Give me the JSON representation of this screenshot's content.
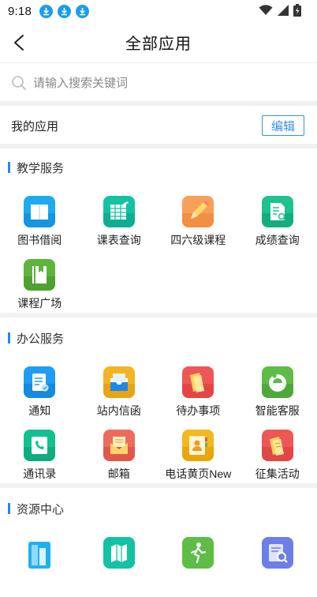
{
  "status": {
    "time": "9:18"
  },
  "header": {
    "title": "全部应用"
  },
  "search": {
    "placeholder": "请输入搜索关键词"
  },
  "my_apps": {
    "label": "我的应用",
    "edit_label": "编辑"
  },
  "sections": [
    {
      "title": "教学服务",
      "apps": [
        {
          "name": "图书借阅",
          "icon": "book-icon"
        },
        {
          "name": "课表查询",
          "icon": "timetable-icon"
        },
        {
          "name": "四六级课程",
          "icon": "pencil-icon"
        },
        {
          "name": "成绩查询",
          "icon": "score-search-icon"
        },
        {
          "name": "课程广场",
          "icon": "course-book-icon"
        }
      ]
    },
    {
      "title": "办公服务",
      "apps": [
        {
          "name": "通知",
          "icon": "notice-icon"
        },
        {
          "name": "站内信函",
          "icon": "inbox-icon"
        },
        {
          "name": "待办事项",
          "icon": "todo-icon"
        },
        {
          "name": "智能客服",
          "icon": "customer-service-icon"
        },
        {
          "name": "通讯录",
          "icon": "phone-book-icon"
        },
        {
          "name": "邮箱",
          "icon": "mail-icon"
        },
        {
          "name": "电话黄页New",
          "icon": "yellow-pages-icon"
        },
        {
          "name": "征集活动",
          "icon": "collect-activity-icon"
        }
      ]
    },
    {
      "title": "资源中心",
      "apps": [
        {
          "name": "",
          "icon": "library-icon"
        },
        {
          "name": "",
          "icon": "map-icon"
        },
        {
          "name": "",
          "icon": "runner-icon"
        },
        {
          "name": "",
          "icon": "doc-search-icon"
        }
      ]
    }
  ],
  "colors": {
    "accent": "#2f83e6",
    "divider": "#f1f1f1"
  }
}
